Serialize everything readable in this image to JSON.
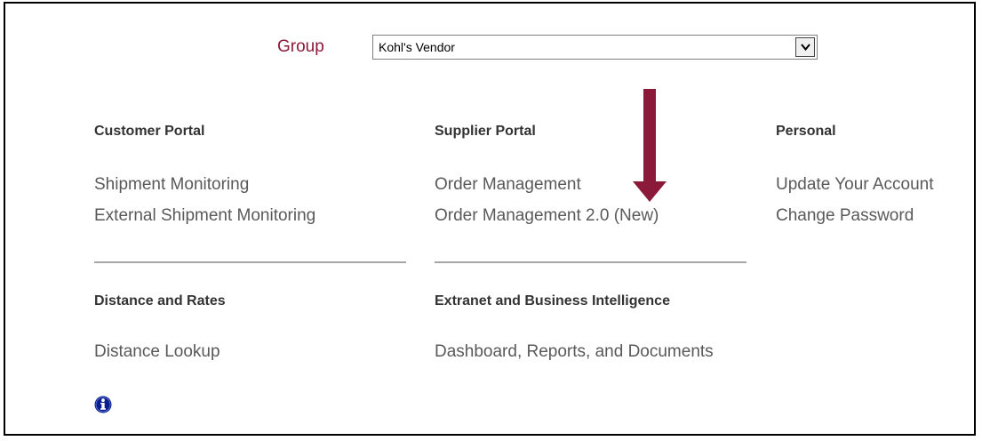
{
  "group": {
    "label": "Group",
    "selected": "Kohl's Vendor"
  },
  "colors": {
    "group_label": "#8b1a3a",
    "arrow": "#8b1a3a",
    "info_icon": "#0a1f8f"
  },
  "sections": {
    "customer_portal": {
      "heading": "Customer Portal",
      "links": [
        "Shipment Monitoring",
        "External Shipment Monitoring"
      ]
    },
    "supplier_portal": {
      "heading": "Supplier Portal",
      "links": [
        "Order Management",
        "Order Management 2.0 (New)"
      ]
    },
    "personal": {
      "heading": "Personal",
      "links": [
        "Update Your Account",
        "Change Password"
      ]
    },
    "distance_rates": {
      "heading": "Distance and Rates",
      "links": [
        "Distance Lookup"
      ]
    },
    "extranet_bi": {
      "heading": "Extranet and Business Intelligence",
      "links": [
        "Dashboard, Reports, and Documents"
      ]
    }
  },
  "icons": {
    "arrow": "down-arrow-icon",
    "info": "info-icon",
    "dropdown": "chevron-down-icon"
  }
}
